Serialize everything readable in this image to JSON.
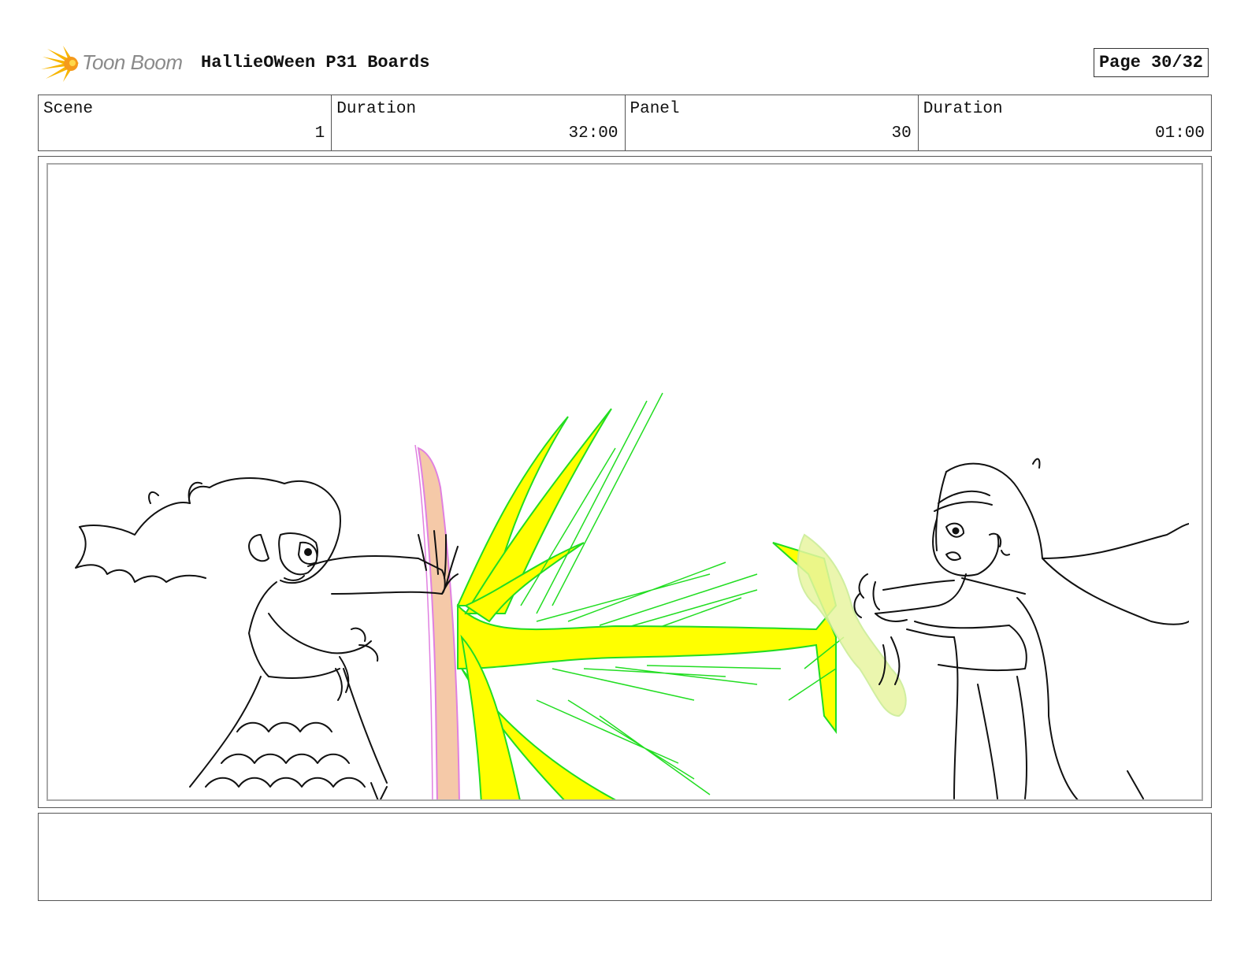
{
  "header": {
    "brand": "Toon Boom",
    "title": "HallieOWeen P31 Boards",
    "page": "Page 30/32"
  },
  "info": {
    "scene_label": "Scene",
    "scene_value": "1",
    "duration_label": "Duration",
    "duration_value": "32:00",
    "panel_label": "Panel",
    "panel_value": "30",
    "panel_duration_label": "Duration",
    "panel_duration_value": "01:00"
  },
  "notes": {
    "text": ""
  },
  "colors": {
    "blast_yellow": "#ffff00",
    "blast_outline": "#22dd22",
    "shield_fill": "#f5c9a8",
    "shield_outline": "#e080e0",
    "glow": "#e8f5a0",
    "logo_orange": "#f5a623"
  }
}
